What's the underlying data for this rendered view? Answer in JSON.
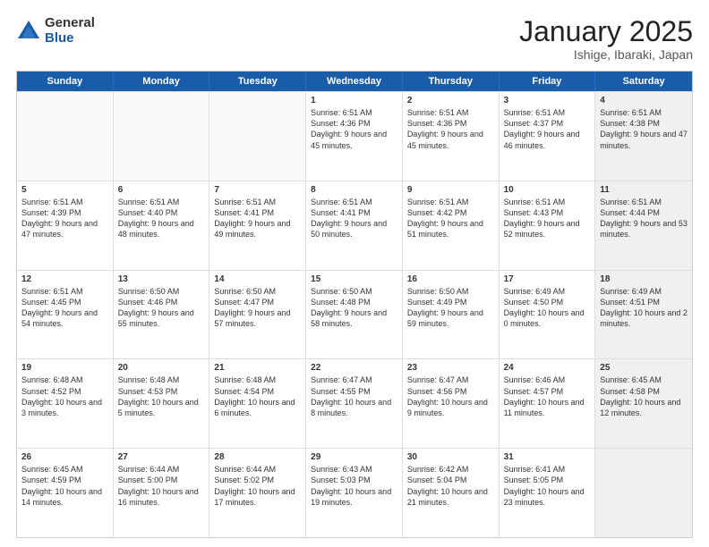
{
  "logo": {
    "general": "General",
    "blue": "Blue"
  },
  "title": {
    "month": "January 2025",
    "location": "Ishige, Ibaraki, Japan"
  },
  "weekdays": [
    "Sunday",
    "Monday",
    "Tuesday",
    "Wednesday",
    "Thursday",
    "Friday",
    "Saturday"
  ],
  "weeks": [
    [
      {
        "day": "",
        "info": "",
        "empty": true
      },
      {
        "day": "",
        "info": "",
        "empty": true
      },
      {
        "day": "",
        "info": "",
        "empty": true
      },
      {
        "day": "1",
        "info": "Sunrise: 6:51 AM\nSunset: 4:36 PM\nDaylight: 9 hours and 45 minutes."
      },
      {
        "day": "2",
        "info": "Sunrise: 6:51 AM\nSunset: 4:36 PM\nDaylight: 9 hours and 45 minutes."
      },
      {
        "day": "3",
        "info": "Sunrise: 6:51 AM\nSunset: 4:37 PM\nDaylight: 9 hours and 46 minutes."
      },
      {
        "day": "4",
        "info": "Sunrise: 6:51 AM\nSunset: 4:38 PM\nDaylight: 9 hours and 47 minutes.",
        "shaded": true
      }
    ],
    [
      {
        "day": "5",
        "info": "Sunrise: 6:51 AM\nSunset: 4:39 PM\nDaylight: 9 hours and 47 minutes."
      },
      {
        "day": "6",
        "info": "Sunrise: 6:51 AM\nSunset: 4:40 PM\nDaylight: 9 hours and 48 minutes."
      },
      {
        "day": "7",
        "info": "Sunrise: 6:51 AM\nSunset: 4:41 PM\nDaylight: 9 hours and 49 minutes."
      },
      {
        "day": "8",
        "info": "Sunrise: 6:51 AM\nSunset: 4:41 PM\nDaylight: 9 hours and 50 minutes."
      },
      {
        "day": "9",
        "info": "Sunrise: 6:51 AM\nSunset: 4:42 PM\nDaylight: 9 hours and 51 minutes."
      },
      {
        "day": "10",
        "info": "Sunrise: 6:51 AM\nSunset: 4:43 PM\nDaylight: 9 hours and 52 minutes."
      },
      {
        "day": "11",
        "info": "Sunrise: 6:51 AM\nSunset: 4:44 PM\nDaylight: 9 hours and 53 minutes.",
        "shaded": true
      }
    ],
    [
      {
        "day": "12",
        "info": "Sunrise: 6:51 AM\nSunset: 4:45 PM\nDaylight: 9 hours and 54 minutes."
      },
      {
        "day": "13",
        "info": "Sunrise: 6:50 AM\nSunset: 4:46 PM\nDaylight: 9 hours and 55 minutes."
      },
      {
        "day": "14",
        "info": "Sunrise: 6:50 AM\nSunset: 4:47 PM\nDaylight: 9 hours and 57 minutes."
      },
      {
        "day": "15",
        "info": "Sunrise: 6:50 AM\nSunset: 4:48 PM\nDaylight: 9 hours and 58 minutes."
      },
      {
        "day": "16",
        "info": "Sunrise: 6:50 AM\nSunset: 4:49 PM\nDaylight: 9 hours and 59 minutes."
      },
      {
        "day": "17",
        "info": "Sunrise: 6:49 AM\nSunset: 4:50 PM\nDaylight: 10 hours and 0 minutes."
      },
      {
        "day": "18",
        "info": "Sunrise: 6:49 AM\nSunset: 4:51 PM\nDaylight: 10 hours and 2 minutes.",
        "shaded": true
      }
    ],
    [
      {
        "day": "19",
        "info": "Sunrise: 6:48 AM\nSunset: 4:52 PM\nDaylight: 10 hours and 3 minutes."
      },
      {
        "day": "20",
        "info": "Sunrise: 6:48 AM\nSunset: 4:53 PM\nDaylight: 10 hours and 5 minutes."
      },
      {
        "day": "21",
        "info": "Sunrise: 6:48 AM\nSunset: 4:54 PM\nDaylight: 10 hours and 6 minutes."
      },
      {
        "day": "22",
        "info": "Sunrise: 6:47 AM\nSunset: 4:55 PM\nDaylight: 10 hours and 8 minutes."
      },
      {
        "day": "23",
        "info": "Sunrise: 6:47 AM\nSunset: 4:56 PM\nDaylight: 10 hours and 9 minutes."
      },
      {
        "day": "24",
        "info": "Sunrise: 6:46 AM\nSunset: 4:57 PM\nDaylight: 10 hours and 11 minutes."
      },
      {
        "day": "25",
        "info": "Sunrise: 6:45 AM\nSunset: 4:58 PM\nDaylight: 10 hours and 12 minutes.",
        "shaded": true
      }
    ],
    [
      {
        "day": "26",
        "info": "Sunrise: 6:45 AM\nSunset: 4:59 PM\nDaylight: 10 hours and 14 minutes."
      },
      {
        "day": "27",
        "info": "Sunrise: 6:44 AM\nSunset: 5:00 PM\nDaylight: 10 hours and 16 minutes."
      },
      {
        "day": "28",
        "info": "Sunrise: 6:44 AM\nSunset: 5:02 PM\nDaylight: 10 hours and 17 minutes."
      },
      {
        "day": "29",
        "info": "Sunrise: 6:43 AM\nSunset: 5:03 PM\nDaylight: 10 hours and 19 minutes."
      },
      {
        "day": "30",
        "info": "Sunrise: 6:42 AM\nSunset: 5:04 PM\nDaylight: 10 hours and 21 minutes."
      },
      {
        "day": "31",
        "info": "Sunrise: 6:41 AM\nSunset: 5:05 PM\nDaylight: 10 hours and 23 minutes."
      },
      {
        "day": "",
        "info": "",
        "empty": true,
        "shaded": true
      }
    ]
  ]
}
